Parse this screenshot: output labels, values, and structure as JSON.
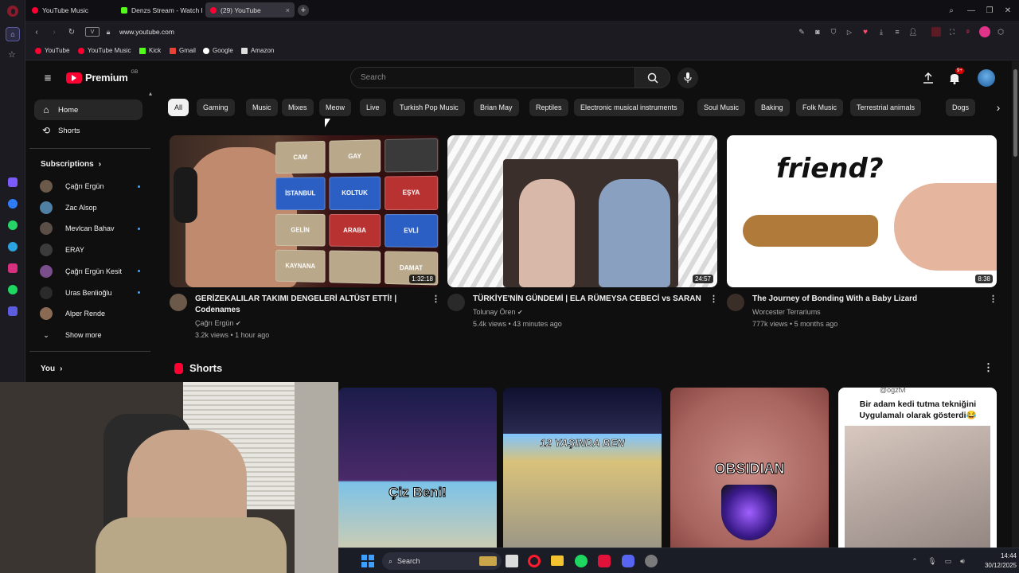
{
  "browser": {
    "tabs": [
      {
        "label": "YouTube Music",
        "color": "#ff0033"
      },
      {
        "label": "Denzs Stream - Watch Liv",
        "color": "#53fc18"
      },
      {
        "label": "(29) YouTube",
        "color": "#ff0033"
      }
    ],
    "url": "www.youtube.com",
    "view_label": "V",
    "bookmarks": [
      {
        "label": "YouTube",
        "icon": "youtube-icon"
      },
      {
        "label": "YouTube Music",
        "icon": "youtube-music-icon"
      },
      {
        "label": "Kick",
        "icon": "kick-icon"
      },
      {
        "label": "Gmail",
        "icon": "gmail-icon"
      },
      {
        "label": "Google",
        "icon": "google-icon"
      },
      {
        "label": "Amazon",
        "icon": "amazon-icon"
      }
    ]
  },
  "youtube": {
    "logo_text": "Premium",
    "logo_sup": "GB",
    "search_placeholder": "Search",
    "notification_count": "9+",
    "sidebar": {
      "items": [
        {
          "label": "Home",
          "icon": "home-icon",
          "active": true
        },
        {
          "label": "Shorts",
          "icon": "shorts-icon",
          "active": false
        }
      ],
      "subscriptions_label": "Subscriptions",
      "subscriptions": [
        {
          "name": "Çağrı Ergün",
          "live": true,
          "color": "#6b5a4a"
        },
        {
          "name": "Zac Alsop",
          "live": false,
          "color": "#4f7fa3"
        },
        {
          "name": "Mevlcan Bahav",
          "live": true,
          "color": "#5a4e46"
        },
        {
          "name": "ERAY",
          "live": false,
          "color": "#3b3b3b"
        },
        {
          "name": "Çağrı Ergün Kesit",
          "live": true,
          "color": "#7a4d8c"
        },
        {
          "name": "Uras Benlioğlu",
          "live": true,
          "color": "#2b2b2b"
        },
        {
          "name": "Alper Rende",
          "live": false,
          "color": "#8a6a52"
        }
      ],
      "show_more": "Show more",
      "you_label": "You"
    },
    "chips": [
      "All",
      "Gaming",
      "Music",
      "Mixes",
      "Meow",
      "Live",
      "Turkish Pop Music",
      "Brian May",
      "Reptiles",
      "Electronic musical instruments",
      "Soul Music",
      "Baking",
      "Folk Music",
      "Terrestrial animals",
      "Dogs"
    ],
    "videos": [
      {
        "title": "GERİZEKALILAR TAKIMI DENGELERİ ALTÜST ETTİ! | Codenames",
        "channel": "Çağrı Ergün",
        "verified": true,
        "stats": "3.2k views • 1 hour ago",
        "duration": "1:32:18"
      },
      {
        "title": "TÜRKİYE'NİN GÜNDEMİ | ELA RÜMEYSA CEBECİ vs SARAN",
        "channel": "Tolunay Ören",
        "verified": true,
        "stats": "5.4k views • 43 minutes ago",
        "duration": "24:57"
      },
      {
        "title": "The Journey of Bonding With a Baby Lizard",
        "channel": "Worcester Terrariums",
        "verified": false,
        "stats": "777k views • 5 months ago",
        "duration": "8:38"
      }
    ],
    "thumb_words": [
      "CAM",
      "GAY",
      "İSTANBUL",
      "KOLTUK",
      "EŞYA",
      "GELİN",
      "ARABA",
      "EVLİ",
      "KAYNANA",
      "DAMAT"
    ],
    "thumb3_text": "friend?",
    "shorts_label": "Shorts",
    "shorts": [
      {
        "overlay": "Çiz Beni!"
      },
      {
        "overlay": "12 YAŞINDA BEN"
      },
      {
        "overlay": "OBSIDIAN"
      },
      {
        "overlay": "Bir adam kedi tutma tekniğini Uygulamalı olarak gösterdi😂",
        "handle": "@ogztvl"
      }
    ]
  },
  "taskbar": {
    "search_label": "Search",
    "time": "14:44",
    "date": "30/12/2025"
  }
}
